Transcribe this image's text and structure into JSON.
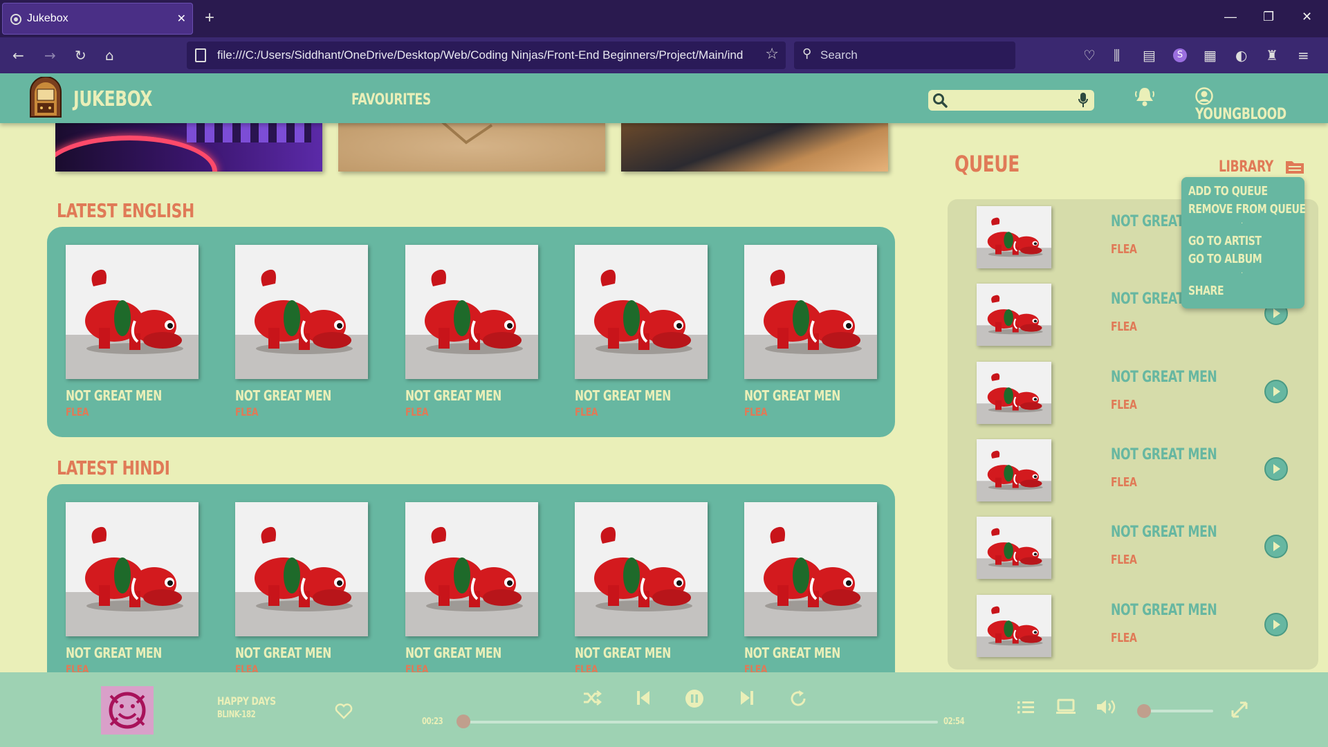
{
  "browser": {
    "tab_title": "Jukebox",
    "url": "file:///C:/Users/Siddhant/OneDrive/Desktop/Web/Coding Ninjas/Front-End Beginners/Project/Main/ind",
    "search_placeholder": "Search",
    "frame_color": "#2a1a4f"
  },
  "app": {
    "brand": "JUKEBOX",
    "nav_favourites": "FAVOURITES",
    "username": "YOUNGBLOOD",
    "accent": "#67b7a1",
    "background": "#eaefb8",
    "title_color": "#e07a57"
  },
  "sections": [
    {
      "title": "LATEST ENGLISH",
      "cards": [
        {
          "song": "NOT GREAT MEN",
          "artist": "FLEA"
        },
        {
          "song": "NOT GREAT MEN",
          "artist": "FLEA"
        },
        {
          "song": "NOT GREAT MEN",
          "artist": "FLEA"
        },
        {
          "song": "NOT GREAT MEN",
          "artist": "FLEA"
        },
        {
          "song": "NOT GREAT MEN",
          "artist": "FLEA"
        }
      ]
    },
    {
      "title": "LATEST HINDI",
      "cards": [
        {
          "song": "NOT GREAT MEN",
          "artist": "FLEA"
        },
        {
          "song": "NOT GREAT MEN",
          "artist": "FLEA"
        },
        {
          "song": "NOT GREAT MEN",
          "artist": "FLEA"
        },
        {
          "song": "NOT GREAT MEN",
          "artist": "FLEA"
        },
        {
          "song": "NOT GREAT MEN",
          "artist": "FLEA"
        }
      ]
    }
  ],
  "queue": {
    "title": "QUEUE",
    "library": "LIBRARY",
    "items": [
      {
        "song": "NOT GREAT MEN",
        "artist": "FLEA"
      },
      {
        "song": "NOT GREAT MEN",
        "artist": "FLEA"
      },
      {
        "song": "NOT GREAT MEN",
        "artist": "FLEA"
      },
      {
        "song": "NOT GREAT MEN",
        "artist": "FLEA"
      },
      {
        "song": "NOT GREAT MEN",
        "artist": "FLEA"
      },
      {
        "song": "NOT GREAT MEN",
        "artist": "FLEA"
      }
    ]
  },
  "context_menu": {
    "add_to_queue": "ADD TO QUEUE",
    "remove_from_queue": "REMOVE FROM QUEUE",
    "go_to_artist": "GO TO ARTIST",
    "go_to_album": "GO TO ALBUM",
    "share": "SHARE"
  },
  "player": {
    "song": "HAPPY DAYS",
    "artist": "BLINK-182",
    "current_time": "00:23",
    "duration": "02:54",
    "progress": 0.0,
    "volume": 0.0
  }
}
